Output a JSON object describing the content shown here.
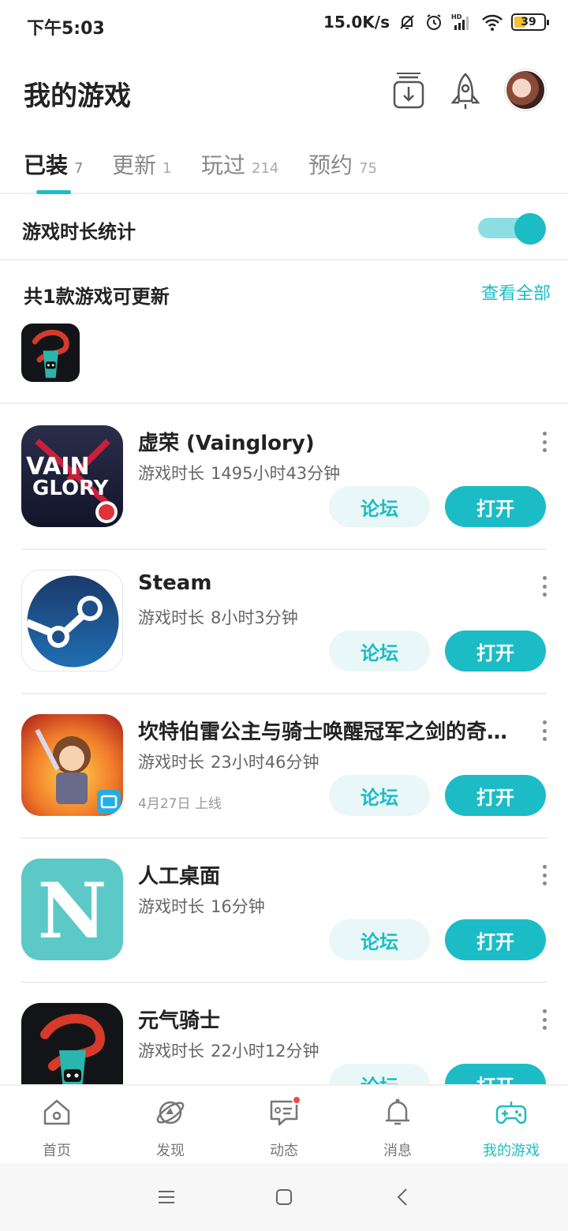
{
  "status_bar": {
    "time": "下午5:03",
    "network_speed": "15.0K/s",
    "battery": "39",
    "battery_level_percent": 39,
    "icons": [
      "mute-bell-icon",
      "alarm-icon",
      "hd-signal-icon",
      "wifi-icon",
      "battery-icon"
    ]
  },
  "header": {
    "title": "我的游戏",
    "icons": [
      "download-manager-icon",
      "rocket-icon",
      "avatar"
    ]
  },
  "tabs": [
    {
      "label": "已装",
      "count": "7",
      "active": true
    },
    {
      "label": "更新",
      "count": "1",
      "active": false
    },
    {
      "label": "玩过",
      "count": "214",
      "active": false
    },
    {
      "label": "预约",
      "count": "75",
      "active": false
    }
  ],
  "play_time_stats": {
    "label": "游戏时长统计",
    "enabled": true
  },
  "updates": {
    "heading": "共1款游戏可更新",
    "see_all": "查看全部",
    "icons": [
      "soul-knight-app-icon"
    ]
  },
  "games": [
    {
      "name": "虚荣 (Vainglory)",
      "duration_label": "游戏时长",
      "duration": "1495小时43分钟",
      "date": "",
      "forum": "论坛",
      "open": "打开",
      "icon": "vainglory-app-icon"
    },
    {
      "name": "Steam",
      "duration_label": "游戏时长",
      "duration": "8小时3分钟",
      "date": "",
      "forum": "论坛",
      "open": "打开",
      "icon": "steam-app-icon"
    },
    {
      "name": "坎特伯雷公主与骑士唤醒冠军之剑的奇...",
      "duration_label": "游戏时长",
      "duration": "23小时46分钟",
      "date": "4月27日 上线",
      "forum": "论坛",
      "open": "打开",
      "icon": "princess-knight-app-icon"
    },
    {
      "name": "人工桌面",
      "duration_label": "游戏时长",
      "duration": "16分钟",
      "date": "",
      "forum": "论坛",
      "open": "打开",
      "icon": "n-launcher-app-icon"
    },
    {
      "name": "元气骑士",
      "duration_label": "游戏时长",
      "duration": "22小时12分钟",
      "date": "",
      "forum": "论坛",
      "open": "打开",
      "icon": "soul-knight-app-icon"
    }
  ],
  "bottom_nav": [
    {
      "label": "首页",
      "icon": "home-icon",
      "active": false
    },
    {
      "label": "发现",
      "icon": "discover-planet-icon",
      "active": false
    },
    {
      "label": "动态",
      "icon": "feed-icon",
      "active": false,
      "badge": true
    },
    {
      "label": "消息",
      "icon": "bell-icon",
      "active": false
    },
    {
      "label": "我的游戏",
      "icon": "gamepad-icon",
      "active": true
    }
  ],
  "system_nav": [
    "menu-icon",
    "home-square-icon",
    "back-icon"
  ],
  "colors": {
    "accent": "#1cbcc6",
    "accent_light": "#e9f7f8",
    "badge_red": "#f04a4a"
  }
}
